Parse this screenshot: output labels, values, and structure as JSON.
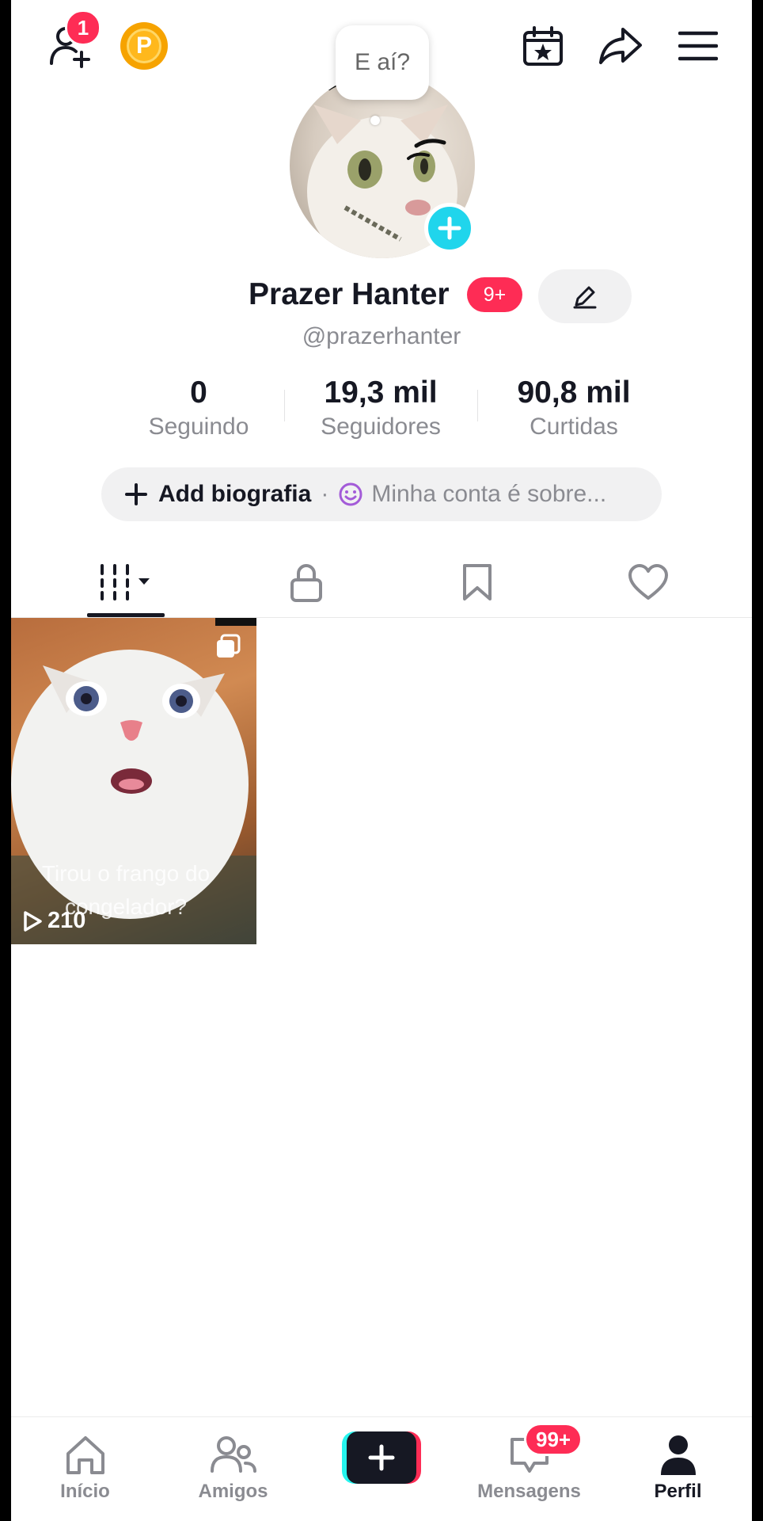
{
  "header": {
    "notification_count": "1",
    "coin_letter": "P",
    "bubble_text": "E aí?"
  },
  "profile": {
    "display_name": "Prazer Hanter",
    "name_badge": "9+",
    "handle": "@prazerhanter"
  },
  "stats": [
    {
      "value": "0",
      "label": "Seguindo"
    },
    {
      "value": "19,3 mil",
      "label": "Seguidores"
    },
    {
      "value": "90,8 mil",
      "label": "Curtidas"
    }
  ],
  "bio": {
    "add_label": "Add biografia",
    "separator": "·",
    "prompt": "Minha conta é sobre..."
  },
  "tabs": [
    {
      "icon": "videos-grid-icon"
    },
    {
      "icon": "lock-icon"
    },
    {
      "icon": "bookmark-icon"
    },
    {
      "icon": "heart-icon"
    }
  ],
  "videos": [
    {
      "caption": "Tirou o frango do congelador?",
      "views": "210"
    }
  ],
  "bottom_nav": {
    "home": "Início",
    "friends": "Amigos",
    "messages": "Mensagens",
    "messages_badge": "99+",
    "profile": "Perfil"
  },
  "colors": {
    "accent_red": "#fe2c55",
    "accent_cyan": "#20d5ec",
    "text_primary": "#161823",
    "text_secondary": "#8a8b91"
  }
}
